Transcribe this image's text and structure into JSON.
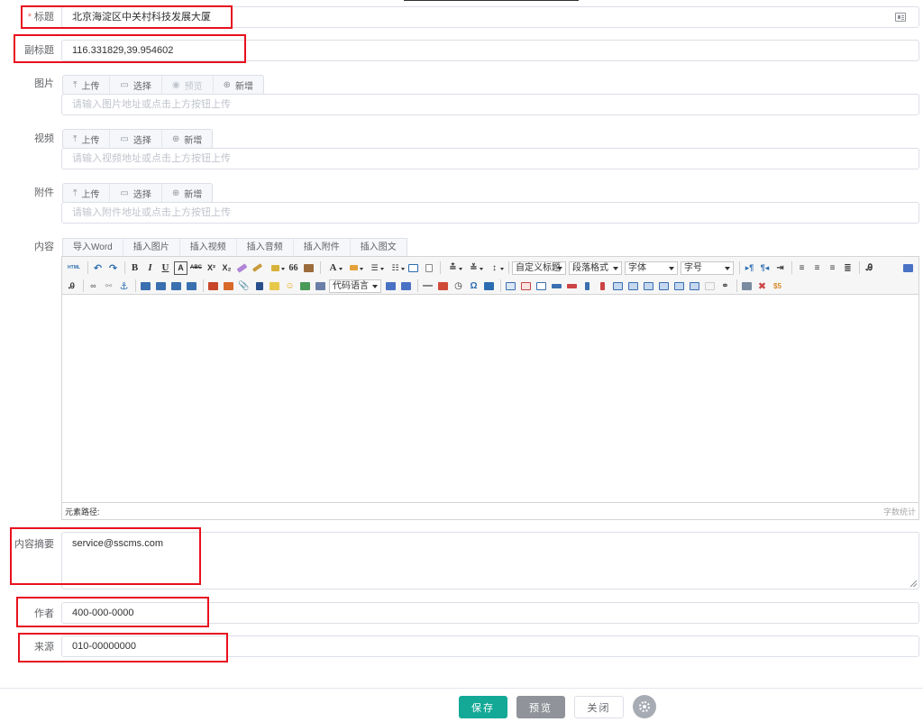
{
  "form": {
    "title": {
      "label": "标题",
      "required_mark": "*",
      "value": "北京海淀区中关村科技发展大厦"
    },
    "subtitle": {
      "label": "副标题",
      "value": "116.331829,39.954602"
    },
    "image": {
      "label": "图片",
      "upload": "上传",
      "select": "选择",
      "preview": "预览",
      "add": "新增",
      "placeholder": "请输入图片地址或点击上方按钮上传"
    },
    "video": {
      "label": "视频",
      "upload": "上传",
      "select": "选择",
      "add": "新增",
      "placeholder": "请输入视频地址或点击上方按钮上传"
    },
    "attachment": {
      "label": "附件",
      "upload": "上传",
      "select": "选择",
      "add": "新增",
      "placeholder": "请输入附件地址或点击上方按钮上传"
    },
    "content": {
      "label": "内容",
      "tabs": [
        "导入Word",
        "插入图片",
        "插入视频",
        "插入音频",
        "插入附件",
        "插入图文"
      ],
      "toolbar": {
        "html_label": "HTML",
        "bold": "B",
        "italic": "I",
        "underline": "U",
        "strike": "ABC",
        "superscript": "X²",
        "subscript": "X₂",
        "quote": "66",
        "font_color": "A",
        "select_title": "自定义标题",
        "select_paragraph": "段落格式",
        "select_font": "字体",
        "select_size": "字号",
        "select_code": "代码语言",
        "omega": "Ω"
      },
      "element_path": "元素路径:",
      "word_count": "字数统计"
    },
    "summary": {
      "label": "内容摘要",
      "value": "service@sscms.com"
    },
    "author": {
      "label": "作者",
      "value": "400-000-0000"
    },
    "source": {
      "label": "来源",
      "value": "010-00000000"
    }
  },
  "footer": {
    "save": "保存",
    "preview": "预览",
    "close": "关闭"
  },
  "colors": {
    "accent": "#13a996",
    "highlight": "#e8101e",
    "muted_button": "#909399"
  },
  "icons": {
    "upload": "upload-icon",
    "select": "folder-icon",
    "preview": "eye-icon",
    "add": "plus-circle-icon",
    "title_side": "card-icon",
    "settings": "gear-icon"
  }
}
